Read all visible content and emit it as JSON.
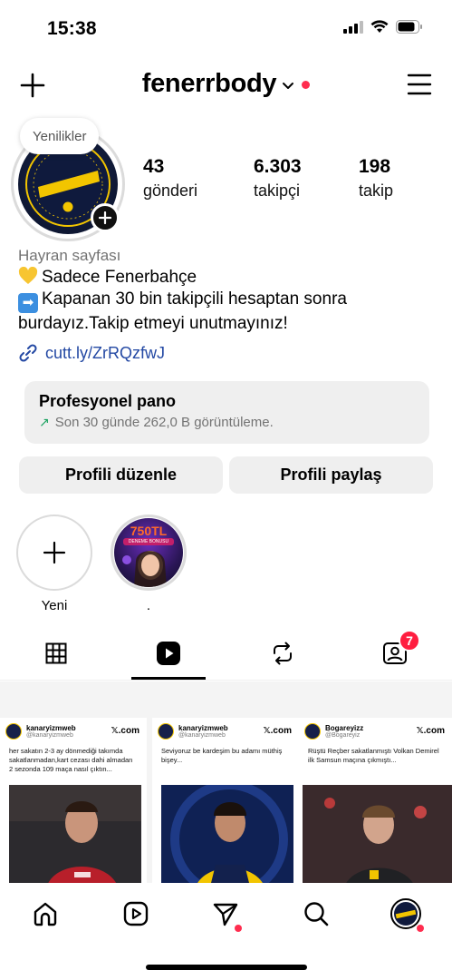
{
  "status_bar": {
    "time": "15:38"
  },
  "header": {
    "username": "fenerrbody"
  },
  "profile": {
    "note": "Yenilikler",
    "avatar_text_top": "FENERBAHÇE",
    "avatar_text_main": "FENERRBODY",
    "stats": [
      {
        "value": "43",
        "label": "gönderi"
      },
      {
        "value": "6.303",
        "label": "takipçi"
      },
      {
        "value": "198",
        "label": "takip"
      }
    ],
    "category": "Hayran sayfası",
    "bio_line1": "Sadece Fenerbahçe",
    "bio_line2": "Kapanan 30 bin takipçili hesaptan sonra",
    "bio_line3": "burdayız.Takip etmeyi unutmayınız!",
    "link": "cutt.ly/ZrRQzfwJ"
  },
  "pro_dashboard": {
    "title": "Profesyonel pano",
    "subtitle": "Son 30 günde 262,0 B görüntüleme."
  },
  "buttons": {
    "edit_profile": "Profili düzenle",
    "share_profile": "Profili paylaş"
  },
  "highlights": [
    {
      "label": "Yeni"
    },
    {
      "label": ".",
      "story_text": "750TL",
      "story_sub": "DENEME BONUSU"
    }
  ],
  "tabs": {
    "tagged_badge": "7"
  },
  "posts": [
    {
      "name": "kanaryizmweb",
      "handle": "@kanaryizmweb",
      "x": "𝕏.com",
      "text": "her sakatın 2-3 ay dönmediği takımda sakatlanmadan,kart cezası dahi almadan 2 sezonda 109 maça nasıl çıktın..."
    },
    {
      "name": "kanaryizmweb",
      "handle": "@kanaryizmweb",
      "x": "𝕏.com",
      "text": "Seviyoruz be kardeşim bu adamı müthiş bişey..."
    },
    {
      "name": "Bogareyizz",
      "handle": "@Bogareyiz",
      "x": "𝕏.com",
      "text": "Rüştü Reçber sakatlanmıştı Volkan Demirel ilk Samsun maçına çıkmıştı..."
    }
  ],
  "colors": {
    "accent_red": "#ff2d4f",
    "link_blue": "#2348a3",
    "panel_gray": "#efefef"
  }
}
